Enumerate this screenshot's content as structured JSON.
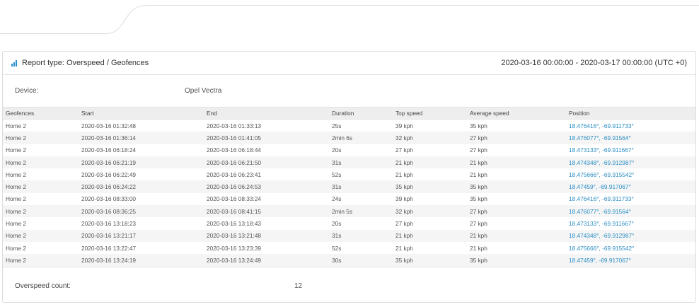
{
  "report": {
    "type_label": "Report type: Overspeed / Geofences",
    "date_range": "2020-03-16 00:00:00 - 2020-03-17 00:00:00 (UTC +0)",
    "device_label": "Device:",
    "device_value": "Opel Vectra",
    "count_label": "Overspeed count:",
    "count_value": "12"
  },
  "table": {
    "headers": [
      "Geofences",
      "Start",
      "End",
      "Duration",
      "Top speed",
      "Average speed",
      "Position"
    ],
    "rows": [
      [
        "Home 2",
        "2020-03-16 01:32:48",
        "2020-03-16 01:33:13",
        "25s",
        "39 kph",
        "35 kph",
        "18.476416°, -69.911733°"
      ],
      [
        "Home 2",
        "2020-03-16 01:36:14",
        "2020-03-16 01:41:05",
        "2min 6s",
        "32 kph",
        "27 kph",
        "18.476077°, -69.91564°"
      ],
      [
        "Home 2",
        "2020-03-16 06:18:24",
        "2020-03-16 06:18:44",
        "20s",
        "27 kph",
        "27 kph",
        "18.473133°, -69.911667°"
      ],
      [
        "Home 2",
        "2020-03-16 06:21:19",
        "2020-03-16 06:21:50",
        "31s",
        "21 kph",
        "21 kph",
        "18.474348°, -69.912987°"
      ],
      [
        "Home 2",
        "2020-03-16 06:22:49",
        "2020-03-16 06:23:41",
        "52s",
        "21 kph",
        "21 kph",
        "18.475666°, -69.915542°"
      ],
      [
        "Home 2",
        "2020-03-16 06:24:22",
        "2020-03-16 06:24:53",
        "31s",
        "35 kph",
        "35 kph",
        "18.47459°, -69.917067°"
      ],
      [
        "Home 2",
        "2020-03-16 08:33:00",
        "2020-03-16 08:33:24",
        "24s",
        "39 kph",
        "35 kph",
        "18.476416°, -69.911733°"
      ],
      [
        "Home 2",
        "2020-03-16 08:36:25",
        "2020-03-16 08:41:15",
        "2min 5s",
        "32 kph",
        "27 kph",
        "18.476077°, -69.91564°"
      ],
      [
        "Home 2",
        "2020-03-16 13:18:23",
        "2020-03-16 13:18:43",
        "20s",
        "27 kph",
        "27 kph",
        "18.473133°, -69.911667°"
      ],
      [
        "Home 2",
        "2020-03-16 13:21:17",
        "2020-03-16 13:21:48",
        "31s",
        "21 kph",
        "21 kph",
        "18.474348°, -69.912987°"
      ],
      [
        "Home 2",
        "2020-03-16 13:22:47",
        "2020-03-16 13:23:39",
        "52s",
        "21 kph",
        "21 kph",
        "18.475666°, -69.915542°"
      ],
      [
        "Home 2",
        "2020-03-16 13:24:19",
        "2020-03-16 13:24:49",
        "30s",
        "35 kph",
        "35 kph",
        "18.47459°, -69.917067°"
      ]
    ]
  },
  "colors": {
    "accent": "#2a90d0",
    "link": "#2a8ec4"
  },
  "icons": {
    "report_type": "bar-chart-icon"
  }
}
